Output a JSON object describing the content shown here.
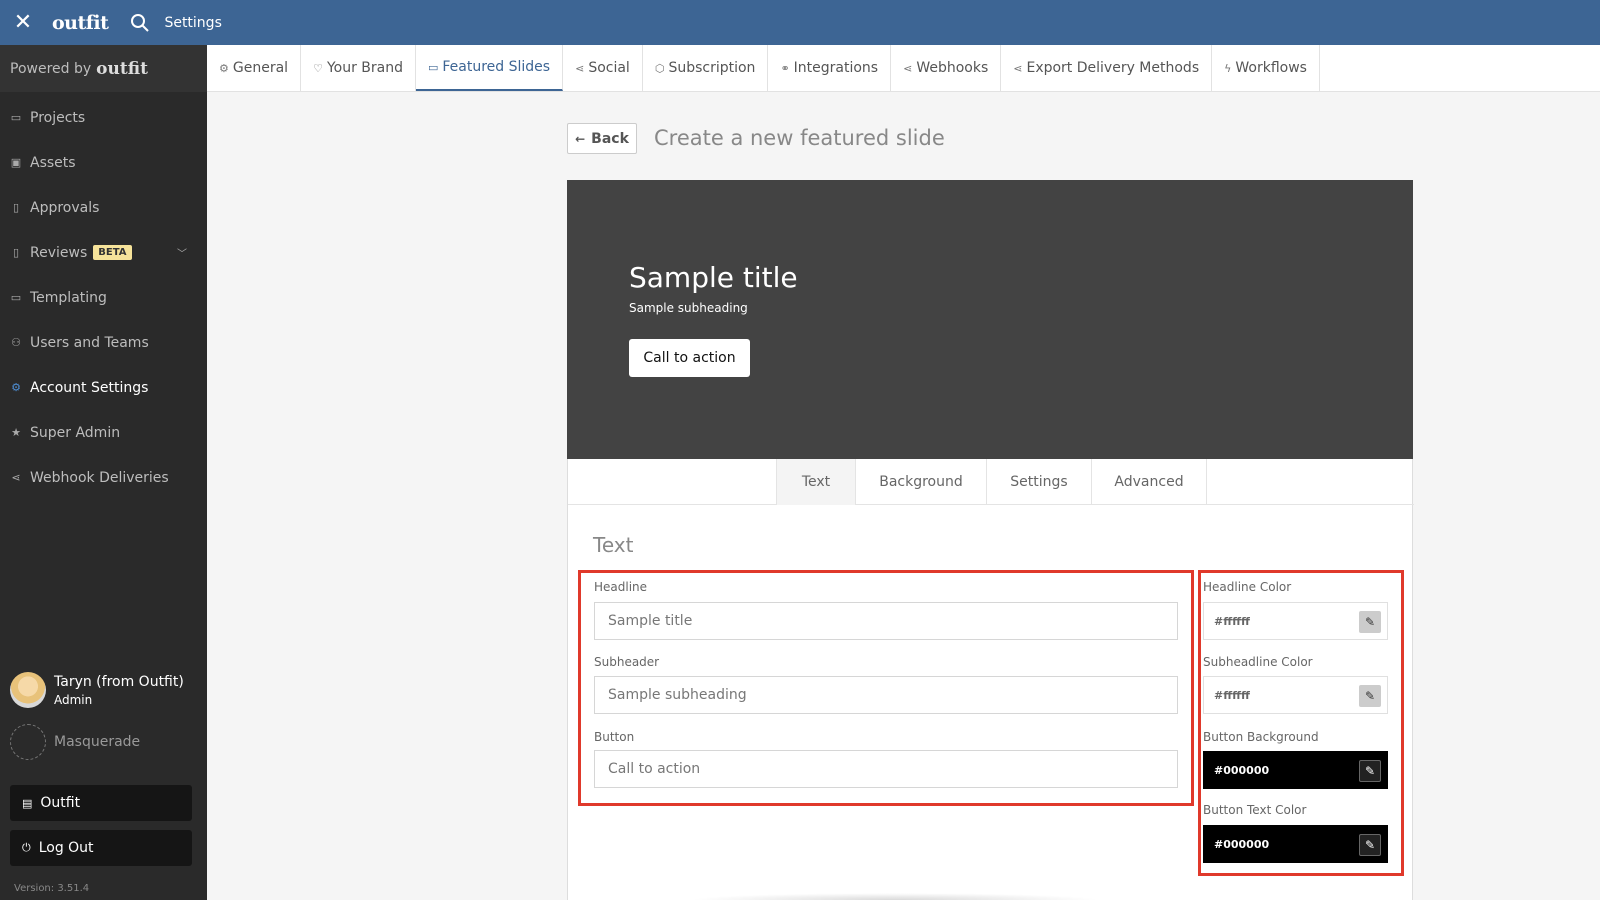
{
  "topbar": {
    "title": "Settings",
    "logo": "outfit"
  },
  "sidebar": {
    "powered_by": "Powered by",
    "powered_brand": "outfit",
    "items": [
      {
        "label": "Projects",
        "icon": "folder-icon"
      },
      {
        "label": "Assets",
        "icon": "image-icon"
      },
      {
        "label": "Approvals",
        "icon": "clipboard-icon"
      },
      {
        "label": "Reviews",
        "icon": "clipboard-icon",
        "badge": "BETA"
      },
      {
        "label": "Templating",
        "icon": "monitor-icon"
      },
      {
        "label": "Users and Teams",
        "icon": "users-icon"
      },
      {
        "label": "Account Settings",
        "icon": "gear-icon"
      },
      {
        "label": "Super Admin",
        "icon": "star-icon"
      },
      {
        "label": "Webhook Deliveries",
        "icon": "share-icon"
      }
    ],
    "user": {
      "name": "Taryn (from Outfit)",
      "role": "Admin"
    },
    "masquerade": "Masquerade",
    "outfit_button": "Outfit",
    "logout_button": "Log Out",
    "version": "Version: 3.51.4"
  },
  "tabs": [
    {
      "label": "General"
    },
    {
      "label": "Your Brand"
    },
    {
      "label": "Featured Slides"
    },
    {
      "label": "Social"
    },
    {
      "label": "Subscription"
    },
    {
      "label": "Integrations"
    },
    {
      "label": "Webhooks"
    },
    {
      "label": "Export Delivery Methods"
    },
    {
      "label": "Workflows"
    }
  ],
  "page": {
    "back_label": "Back",
    "title": "Create a new featured slide"
  },
  "preview": {
    "title": "Sample title",
    "subheading": "Sample subheading",
    "cta": "Call to action"
  },
  "editor": {
    "subtabs": [
      "Text",
      "Background",
      "Settings",
      "Advanced"
    ],
    "section_title": "Text",
    "fields": {
      "headline_label": "Headline",
      "headline_value": "Sample title",
      "subheader_label": "Subheader",
      "subheader_value": "Sample subheading",
      "button_label": "Button",
      "button_value": "Call to action"
    },
    "colors": {
      "headline_color_label": "Headline Color",
      "headline_color_value": "#ffffff",
      "subheadline_color_label": "Subheadline Color",
      "subheadline_color_value": "#ffffff",
      "button_bg_label": "Button Background",
      "button_bg_value": "#000000",
      "button_text_label": "Button Text Color",
      "button_text_value": "#000000"
    }
  },
  "theme": {
    "accent": "#3d6594",
    "highlight": "#e0392b",
    "sidebar_bg": "#2a2a2a"
  }
}
